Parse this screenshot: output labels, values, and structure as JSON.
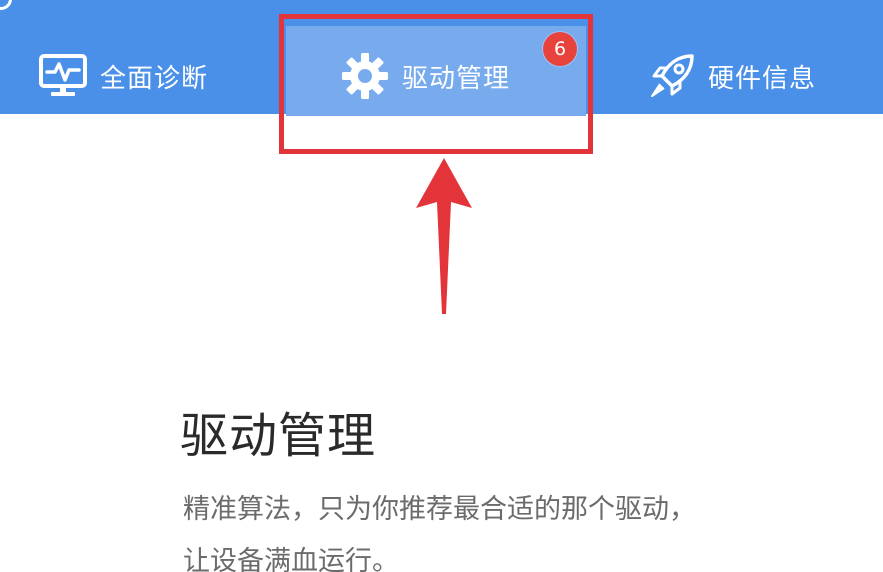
{
  "tabs": [
    {
      "id": "diagnose",
      "label": "全面诊断",
      "icon": "monitor-pulse-icon",
      "active": false
    },
    {
      "id": "driver",
      "label": "驱动管理",
      "icon": "gear-icon",
      "active": true,
      "badge": "6"
    },
    {
      "id": "hardware",
      "label": "硬件信息",
      "icon": "rocket-icon",
      "active": false
    }
  ],
  "feature": {
    "title": "驱动管理",
    "description_line1": "精准算法，只为你推荐最合适的那个驱动，",
    "description_line2": "让设备满血运行。"
  },
  "colors": {
    "topbar": "#4a90e8",
    "active_tab": "#77abee",
    "badge": "#e8423c",
    "highlight": "#e3343a"
  }
}
